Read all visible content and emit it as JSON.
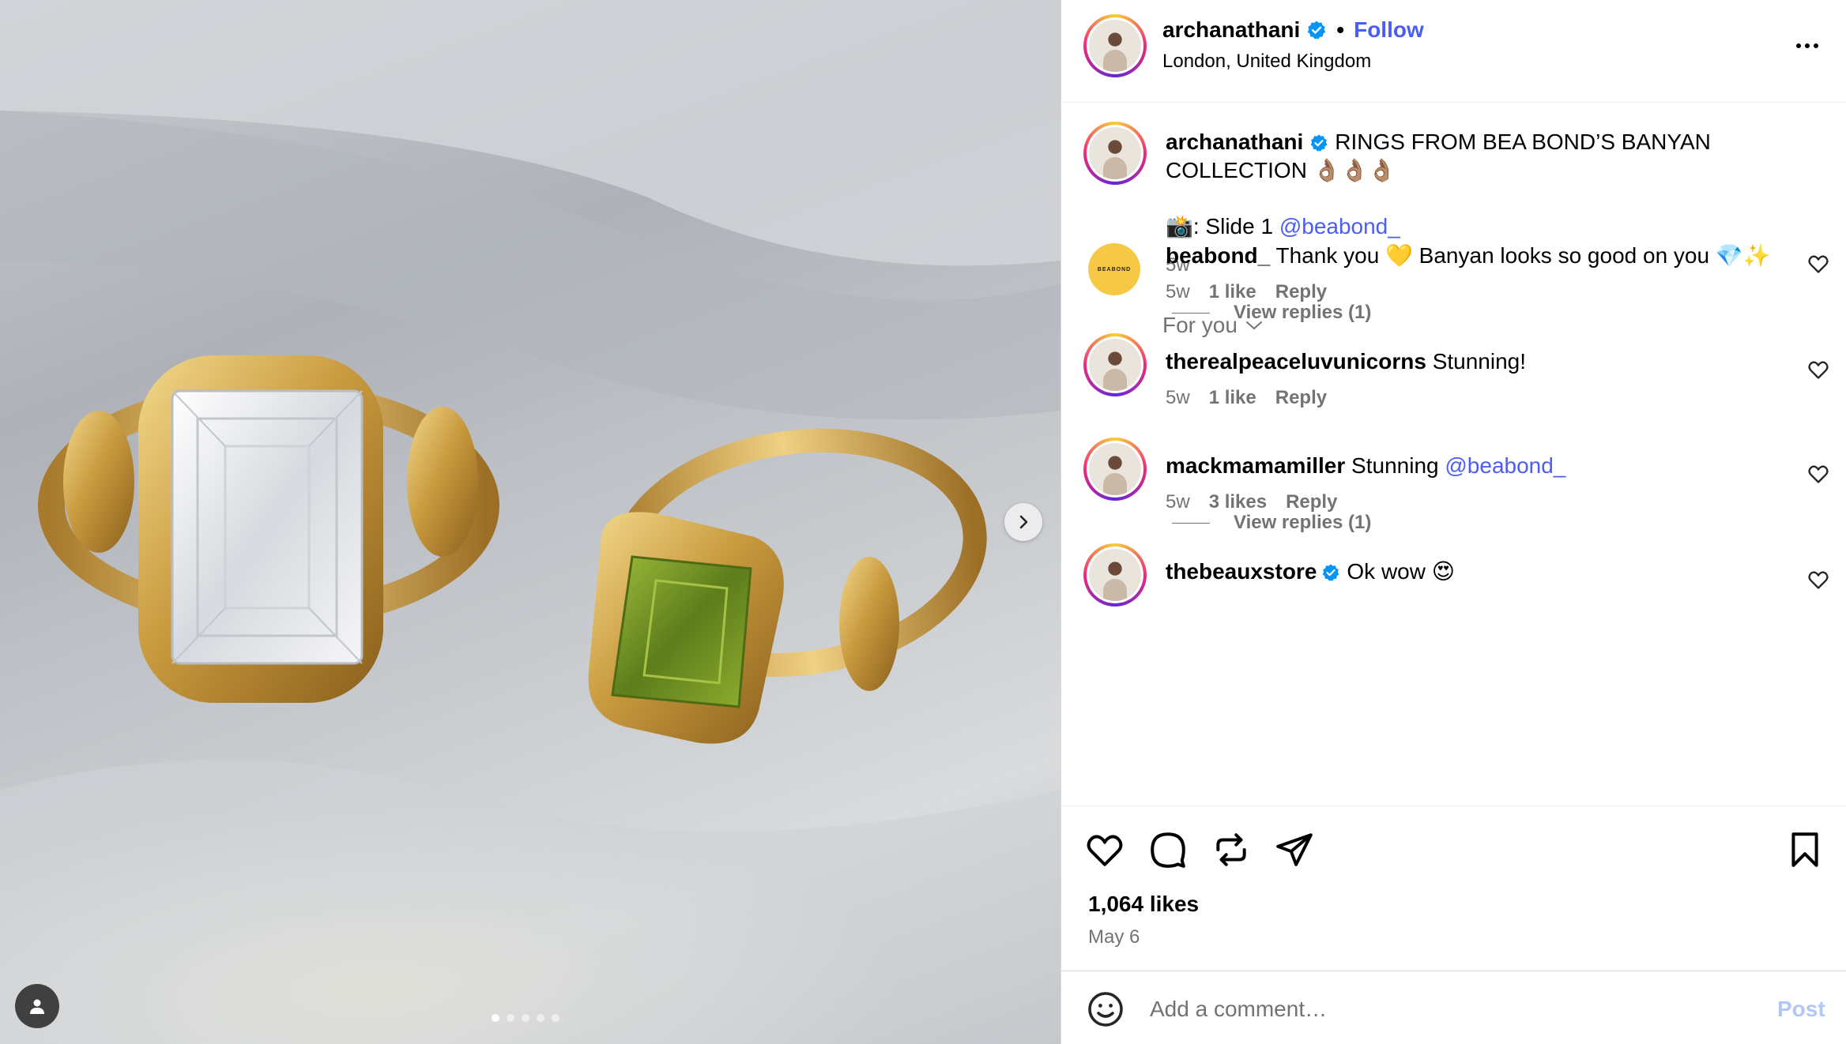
{
  "media": {
    "carousel_count": 5,
    "carousel_active_index": 0
  },
  "header": {
    "username": "archanathani",
    "separator": "•",
    "follow_label": "Follow",
    "location": "London, United Kingdom"
  },
  "caption": {
    "username": "archanathani",
    "text": "RINGS FROM BEA BOND’S BANYAN COLLECTION 👌🏽👌🏽👌🏽",
    "credit_prefix": "📸: Slide 1 ",
    "credit_mention": "@beabond_",
    "time": "5w"
  },
  "filter": {
    "label": "For you"
  },
  "comments": [
    {
      "username": "beabond_",
      "text": "Thank you 💛 Banyan looks so good on you 💎✨",
      "time": "5w",
      "likes": "1 like",
      "reply": "Reply",
      "view_replies": "View replies (1)",
      "avatar_text": "BEABOND"
    },
    {
      "username": "therealpeaceluvunicorns",
      "text": "Stunning!",
      "time": "5w",
      "likes": "1 like",
      "reply": "Reply"
    },
    {
      "username": "mackmamamiller",
      "text": "Stunning ",
      "mention": "@beabond_",
      "time": "5w",
      "likes": "3 likes",
      "reply": "Reply",
      "view_replies": "View replies (1)"
    },
    {
      "username": "thebeauxstore",
      "text": "Ok wow 😍"
    }
  ],
  "footer": {
    "likes": "1,064 likes",
    "date": "May 6",
    "comment_placeholder": "Add a comment…",
    "post_label": "Post"
  },
  "colors": {
    "link": "#4a5df9",
    "secondary_text": "#737373",
    "verified": "#0095f6",
    "post_disabled": "#b2c7f7"
  }
}
